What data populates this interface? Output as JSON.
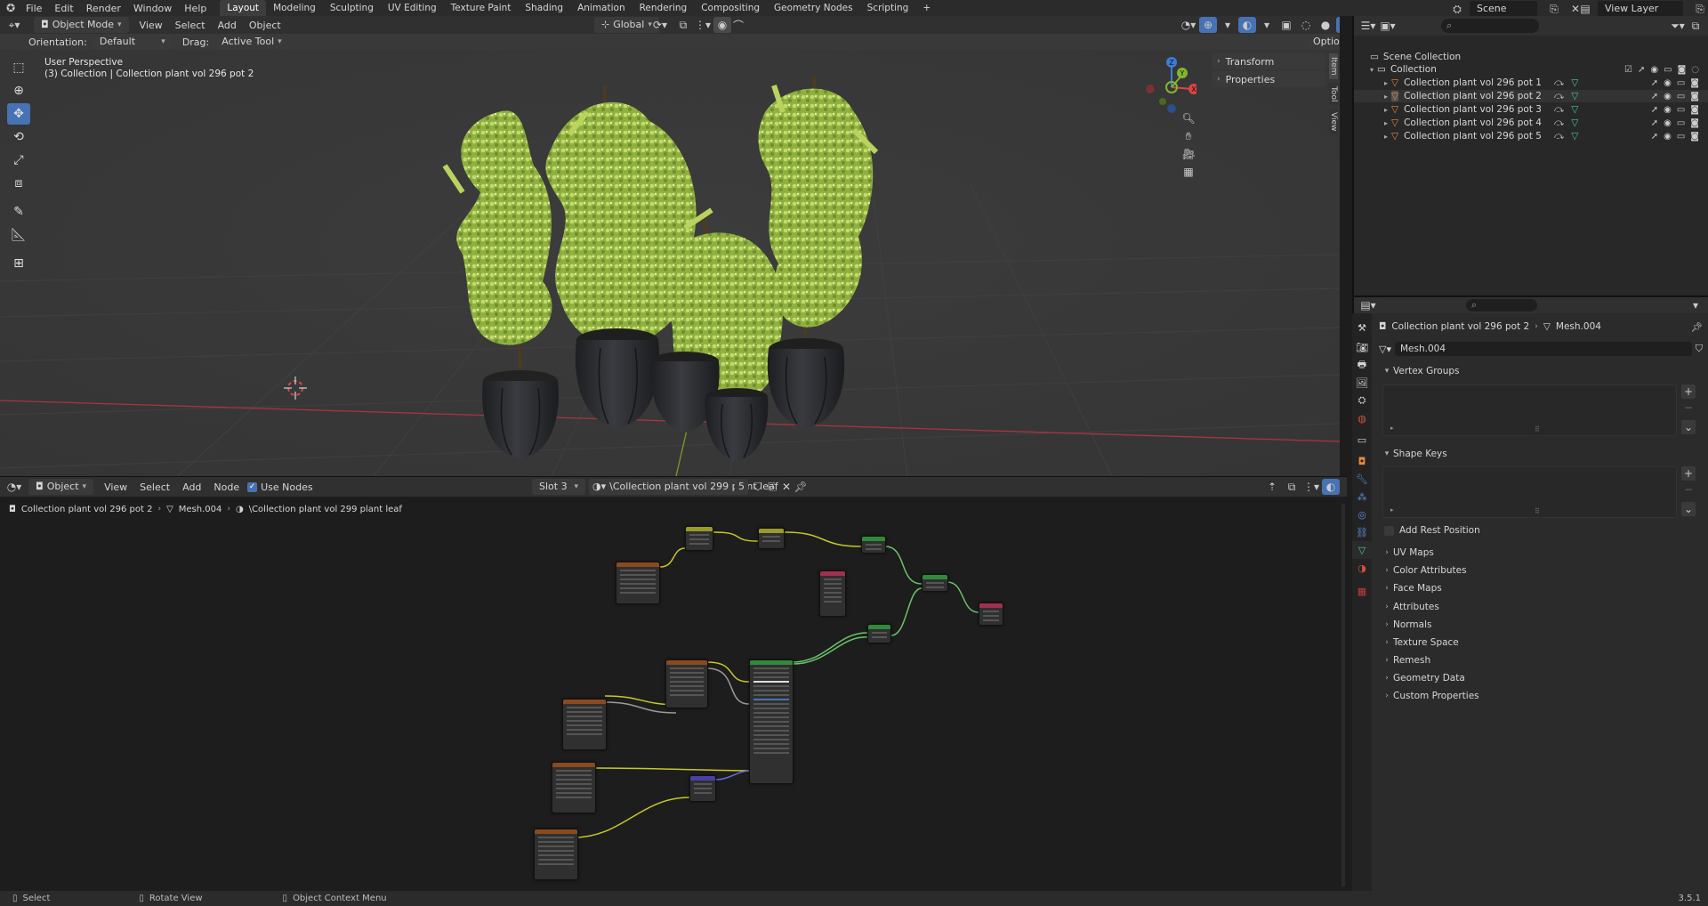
{
  "topbar": {
    "menus": [
      "File",
      "Edit",
      "Render",
      "Window",
      "Help"
    ],
    "workspaces": [
      "Layout",
      "Modeling",
      "Sculpting",
      "UV Editing",
      "Texture Paint",
      "Shading",
      "Animation",
      "Rendering",
      "Compositing",
      "Geometry Nodes",
      "Scripting"
    ],
    "active_workspace": "Layout",
    "add_tab": "+",
    "scene": "Scene",
    "view_layer": "View Layer"
  },
  "viewport": {
    "mode": "Object Mode",
    "menus": [
      "View",
      "Select",
      "Add",
      "Object"
    ],
    "transform_orientation": "Global",
    "orientation_label": "Orientation:",
    "orientation_value": "Default",
    "drag_label": "Drag:",
    "drag_value": "Active Tool",
    "options": "Options",
    "overlay_title": "User Perspective",
    "overlay_sub": "(3) Collection | Collection plant vol 296 pot 2",
    "npanel": {
      "transform": "Transform",
      "properties": "Properties",
      "tabs": [
        "Item",
        "Tool",
        "View"
      ]
    },
    "gizmo": {
      "z": "Z",
      "y": "Y",
      "x": "X"
    }
  },
  "node_editor": {
    "type": "Object",
    "menus": [
      "View",
      "Select",
      "Add",
      "Node"
    ],
    "use_nodes": "Use Nodes",
    "slot": "Slot 3",
    "material": "\\Collection plant vol 299 plant leaf",
    "users": "5",
    "breadcrumb": [
      "Collection plant vol 296 pot 2",
      "Mesh.004",
      "\\Collection plant vol 299 plant leaf"
    ]
  },
  "outliner": {
    "root": "Scene Collection",
    "collection": "Collection",
    "items": [
      "Collection plant vol 296 pot 1",
      "Collection plant vol 296 pot 2",
      "Collection plant vol 296 pot 3",
      "Collection plant vol 296 pot 4",
      "Collection plant vol 296 pot 5"
    ]
  },
  "properties": {
    "object": "Collection plant vol 296 pot 2",
    "mesh": "Mesh.004",
    "mesh_field": "Mesh.004",
    "vertex_groups": "Vertex Groups",
    "shape_keys": "Shape Keys",
    "add_rest_position": "Add Rest Position",
    "collapsed": [
      "UV Maps",
      "Color Attributes",
      "Face Maps",
      "Attributes",
      "Normals",
      "Texture Space",
      "Remesh",
      "Geometry Data",
      "Custom Properties"
    ]
  },
  "statusbar": {
    "select": "Select",
    "rotate": "Rotate View",
    "context": "Object Context Menu",
    "version": "3.5.1"
  },
  "colors": {
    "accent": "#4772b3",
    "header": "#303030",
    "viewport": "#393939",
    "node_bg": "#1d1d1d",
    "panel_bg": "#2b2b2b",
    "leaf": "#9bbd4a",
    "pot": "#2e2f33"
  }
}
